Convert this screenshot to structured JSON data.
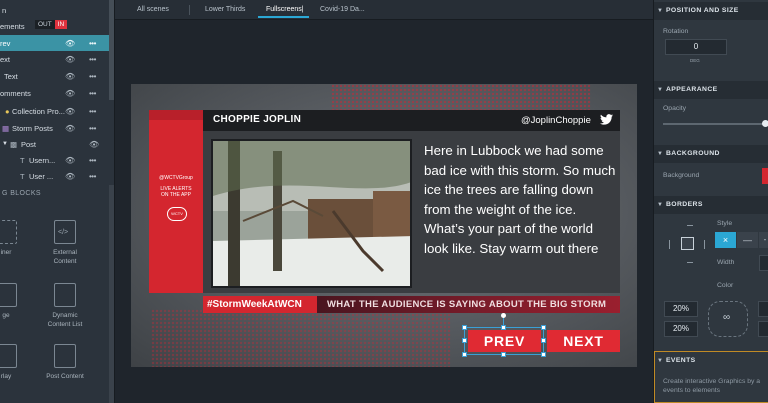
{
  "left_panel": {
    "layers": [
      {
        "label": "ements",
        "eye": "👁",
        "dots": "•••"
      },
      {
        "label": "rev",
        "eye": "👁",
        "dots": "•••"
      },
      {
        "label": "ext",
        "eye": "👁",
        "dots": "•••"
      },
      {
        "label": "Text",
        "eye": "👁",
        "dots": "•••"
      },
      {
        "label": "omments",
        "eye": "👁",
        "dots": "•••"
      },
      {
        "label": "Collection Pro...",
        "eye": "👁",
        "dots": "•••"
      },
      {
        "label": "Storm Posts",
        "eye": "👁",
        "dots": "•••"
      },
      {
        "label": "Post",
        "eye": "👁",
        "dots": ""
      },
      {
        "label": "Usern...",
        "eye": "👁",
        "dots": "•••"
      },
      {
        "label": "User ...",
        "eye": "👁",
        "dots": "•••"
      }
    ],
    "top_label": "n",
    "out_label": "OUT",
    "in_label": "IN",
    "blocks_header": "G BLOCKS",
    "blocks": [
      {
        "label": "iner",
        "icon": "container-icon"
      },
      {
        "label": "External Content",
        "icon": "external-content-icon"
      },
      {
        "label": "ge",
        "icon": "image-icon"
      },
      {
        "label": "Dynamic Content List",
        "icon": "dynamic-list-icon"
      },
      {
        "label": "rlay",
        "icon": "overlay-icon"
      },
      {
        "label": "Post Content",
        "icon": "post-content-icon"
      }
    ]
  },
  "tabs": [
    "All scenes",
    "Lower Thirds",
    "Fullscreens|",
    "Covid-19 Da..."
  ],
  "graphic": {
    "side_handle": "@WCTVGroup",
    "side_alert": "LIVE ALERTS ON THE APP",
    "side_logo": "WCTV",
    "author": "CHOPPIE JOPLIN",
    "handle": "@JoplinChoppie",
    "post_text": "Here in Lubbock we had some bad ice with this storm. So much ice the trees are falling down from the weight of the ice. What’s your part of the world look like. Stay warm out there",
    "hashtag": "#StormWeekAtWCN",
    "headline": "WHAT THE AUDIENCE IS SAYING ABOUT THE BIG STORM",
    "prev_label": "PREV",
    "next_label": "NEXT"
  },
  "right_panel": {
    "position_header": "POSITION AND SIZE",
    "rotation_label": "Rotation",
    "rotation_value": "0",
    "deg_label": "DEG",
    "appearance_header": "APPEARANCE",
    "opacity_label": "Opacity",
    "background_header": "BACKGROUND",
    "background_label": "Background",
    "borders_header": "BORDERS",
    "style_label": "Style",
    "width_label": "Width",
    "color_label": "Color",
    "radius_tl": "20%",
    "radius_bl": "20%",
    "events_header": "EVENTS",
    "events_desc": "Create interactive Graphics by a events to elements"
  },
  "colors": {
    "accent": "#2ba7d4",
    "brand_red": "#d4262f",
    "selection": "#3b93a5",
    "events_border": "#c08a25"
  }
}
